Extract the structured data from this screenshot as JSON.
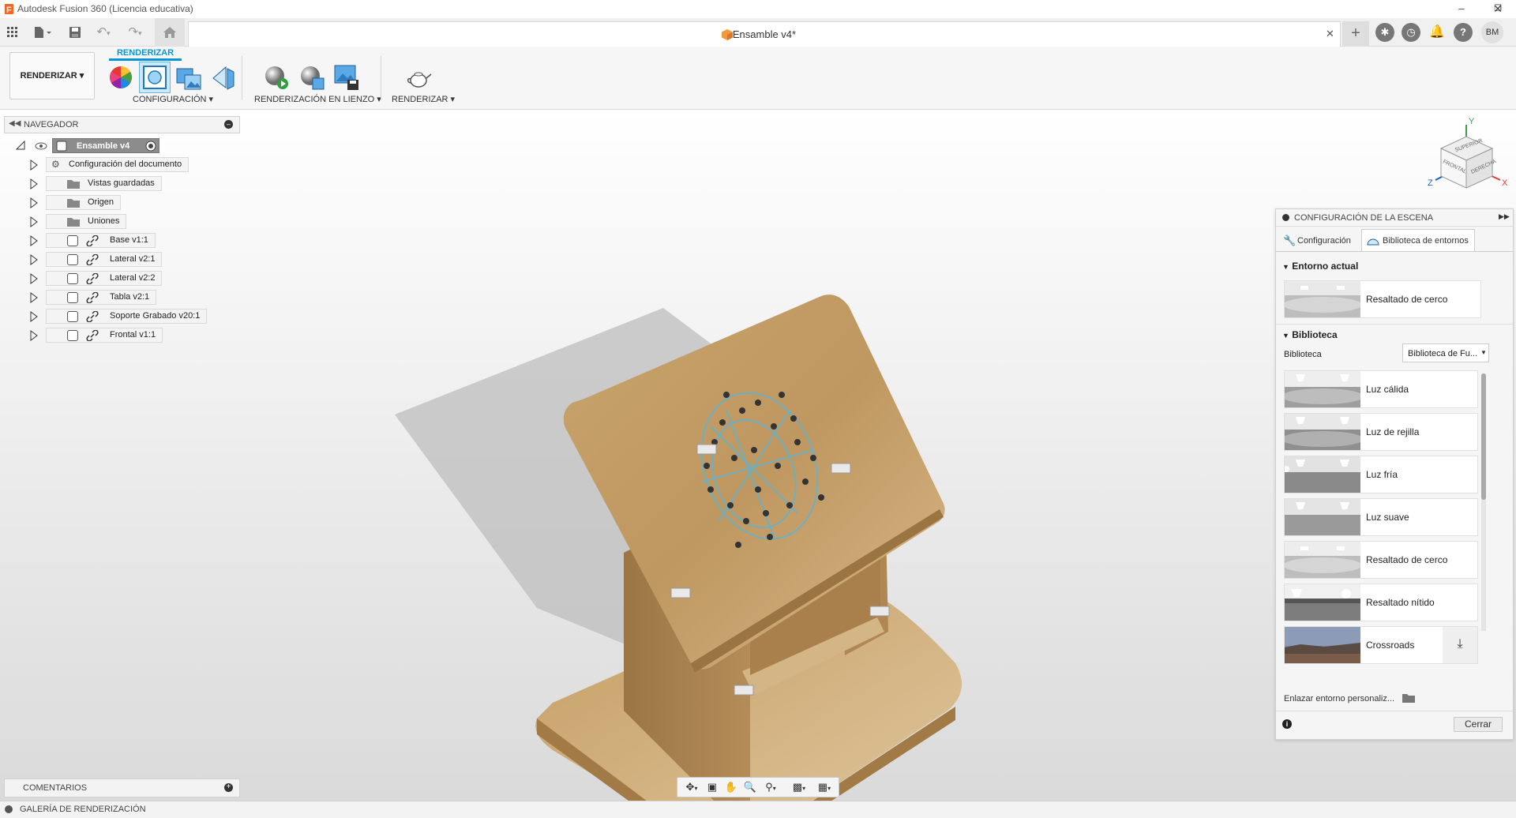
{
  "app": {
    "window_title": "Autodesk Fusion 360 (Licencia educativa)"
  },
  "document": {
    "tab_title": "Ensamble v4*",
    "close_glyph": "✕"
  },
  "user": {
    "initials": "BM"
  },
  "toolbar": {
    "workspace_label": "RENDERIZAR ▾",
    "active_tab": "RENDERIZAR",
    "groups": [
      {
        "label": "CONFIGURACIÓN ▾"
      },
      {
        "label": "RENDERIZACIÓN EN LIENZO ▾"
      },
      {
        "label": "RENDERIZAR ▾"
      }
    ]
  },
  "navigator": {
    "title": "NAVEGADOR",
    "root": "Ensamble v4",
    "items": [
      {
        "label": "Configuración del documento",
        "icon": "gear-icon"
      },
      {
        "label": "Vistas guardadas",
        "icon": "folder-icon"
      },
      {
        "label": "Origen",
        "icon": "folder-icon",
        "hidden": true
      },
      {
        "label": "Uniones",
        "icon": "folder-icon"
      },
      {
        "label": "Base v1:1",
        "icon": "component-icon"
      },
      {
        "label": "Lateral v2:1",
        "icon": "component-icon"
      },
      {
        "label": "Lateral v2:2",
        "icon": "component-icon"
      },
      {
        "label": "Tabla v2:1",
        "icon": "component-icon"
      },
      {
        "label": "Soporte Grabado v20:1",
        "icon": "component-icon"
      },
      {
        "label": "Frontal v1:1",
        "icon": "component-icon"
      }
    ]
  },
  "comments": {
    "title": "COMENTARIOS"
  },
  "gallery": {
    "title": "GALERÍA DE RENDERIZACIÓN"
  },
  "viewcube": {
    "top": "SUPERIOR",
    "front": "FRONTAL",
    "right": "DERECHA",
    "axis_x": "X",
    "axis_y": "Y",
    "axis_z": "Z"
  },
  "scene": {
    "title": "CONFIGURACIÓN DE LA ESCENA",
    "tabs": [
      "Configuración",
      "Biblioteca de entornos"
    ],
    "current_section": "Entorno actual",
    "current_env": "Resaltado de cerco",
    "library_section": "Biblioteca",
    "library_label": "Biblioteca",
    "library_select": "Biblioteca de Fu...",
    "environments": [
      {
        "name": "Luz cálida"
      },
      {
        "name": "Luz de rejilla"
      },
      {
        "name": "Luz fría"
      },
      {
        "name": "Luz suave"
      },
      {
        "name": "Resaltado de cerco"
      },
      {
        "name": "Resaltado nítido"
      },
      {
        "name": "Crossroads"
      }
    ],
    "link_custom": "Enlazar entorno personaliz...",
    "close_button": "Cerrar"
  },
  "colors": {
    "accent": "#0696d7",
    "panel": "#f5f5f5",
    "wood": "#c19a63"
  }
}
